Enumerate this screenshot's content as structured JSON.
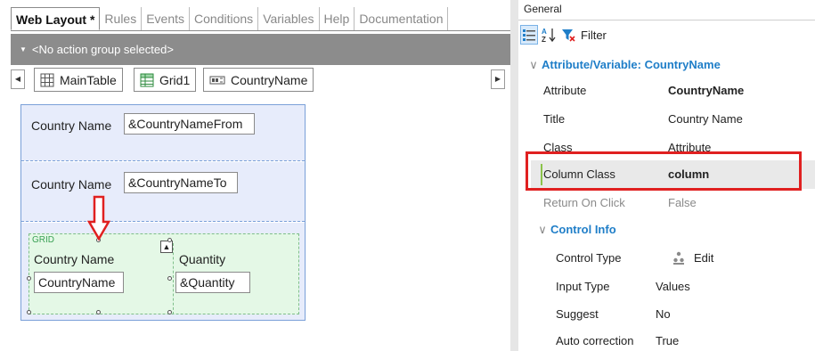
{
  "tabs": [
    {
      "label": "Web Layout *",
      "active": true
    },
    {
      "label": "Rules",
      "active": false
    },
    {
      "label": "Events",
      "active": false
    },
    {
      "label": "Conditions",
      "active": false
    },
    {
      "label": "Variables",
      "active": false
    },
    {
      "label": "Help",
      "active": false
    },
    {
      "label": "Documentation",
      "active": false
    }
  ],
  "action_group": "<No action group selected>",
  "breadcrumbs": [
    "MainTable",
    "Grid1",
    "CountryName"
  ],
  "form": {
    "row1": {
      "label": "Country Name",
      "field": "&CountryNameFrom"
    },
    "row2": {
      "label": "Country Name",
      "field": "&CountryNameTo"
    },
    "grid": {
      "tag": "GRID",
      "col1_header": "Country Name",
      "col1_field": "CountryName",
      "col2_header": "Quantity",
      "col2_field": "&Quantity"
    }
  },
  "props_panel": {
    "title": "General",
    "filter_label": "Filter",
    "section_main": "Attribute/Variable: CountryName",
    "rows": [
      {
        "name": "Attribute",
        "value": "CountryName"
      },
      {
        "name": "Title",
        "value": "Country Name"
      },
      {
        "name": "Class",
        "value": "Attribute"
      },
      {
        "name": "Column Class",
        "value": "column"
      },
      {
        "name": "Return On Click",
        "value": "False"
      }
    ],
    "section_control": "Control Info",
    "control_rows": [
      {
        "name": "Control Type",
        "value": "Edit"
      },
      {
        "name": "Input Type",
        "value": "Values"
      },
      {
        "name": "Suggest",
        "value": "No"
      },
      {
        "name": "Auto correction",
        "value": "True"
      }
    ]
  },
  "colors": {
    "accent_blue": "#1f7ec8",
    "highlight_red": "#e02020",
    "grid_green": "#e4f8e6",
    "form_blue": "#e7ecfb"
  }
}
